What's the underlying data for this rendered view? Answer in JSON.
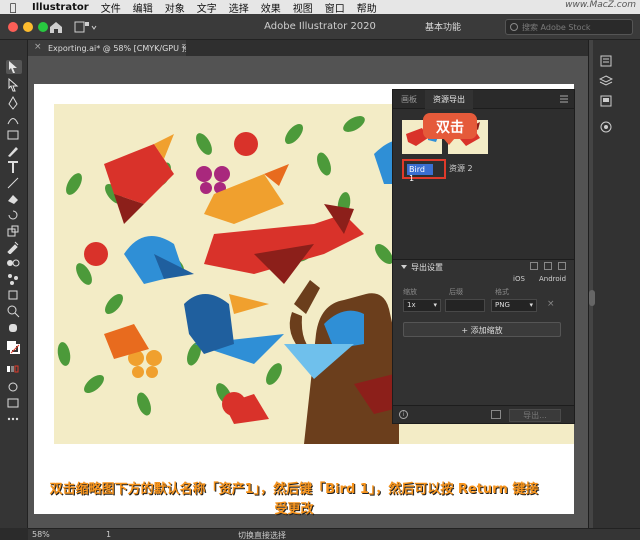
{
  "menubar": {
    "app_name": "Illustrator",
    "items": [
      "文件",
      "编辑",
      "对象",
      "文字",
      "选择",
      "效果",
      "视图",
      "窗口",
      "帮助"
    ],
    "watermark": "www.MacZ.com"
  },
  "appbar": {
    "title": "Adobe Illustrator 2020",
    "workspace": "基本功能",
    "stock_placeholder": "搜索 Adobe Stock"
  },
  "document": {
    "tab_title": "Exporting.ai* @ 58% [CMYK/GPU 预览]"
  },
  "assets_panel": {
    "tabs": [
      "画板",
      "资源导出"
    ],
    "callout": "双击",
    "asset_name_editing": "Bird 1",
    "asset2_name": "资源 2",
    "export_settings": {
      "header": "导出设置",
      "platforms": [
        "iOS",
        "Android"
      ],
      "columns": [
        "缩放",
        "后缀",
        "格式"
      ],
      "row": {
        "scale": "1x",
        "suffix": "",
        "format": "PNG"
      },
      "add_scale": "+ 添加缩放"
    },
    "export_button": "导出..."
  },
  "caption": {
    "line1": "双击缩略图下方的默认名称「资产1」，然后键「Bird 1」，然后可以按 Return 键接",
    "line2": "受更改"
  },
  "statusbar": {
    "zoom": "58%",
    "page": "1",
    "tool": "切换直接选择"
  },
  "colors": {
    "accent_red": "#e03a2a",
    "callout": "#e55a3a",
    "caption": "#f7941d",
    "selection_blue": "#3a6fd1"
  }
}
